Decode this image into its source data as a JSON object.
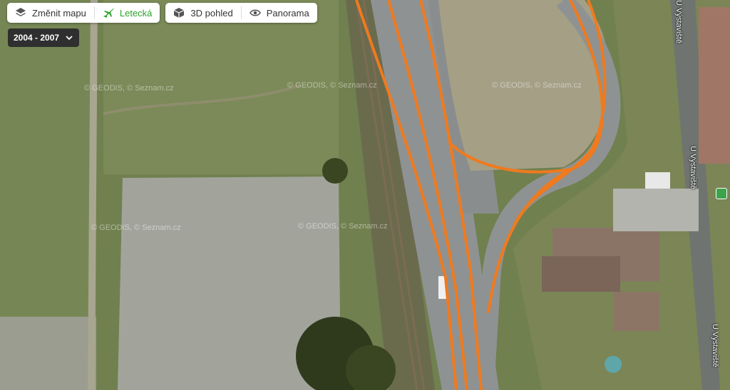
{
  "toolbar": {
    "change_map_label": "Změnit mapu",
    "aerial_label": "Letecká",
    "view3d_label": "3D pohled",
    "panorama_label": "Panorama"
  },
  "date_range": "2004 - 2007",
  "watermarks": [
    "© GEODIS, © Seznam.cz",
    "© GEODIS, © Seznam.cz",
    "© GEODIS, © Seznam.cz",
    "© GEODIS, © Seznam.cz",
    "© GEODIS, © Seznam.cz"
  ],
  "streets": [
    "U Výstaviště",
    "U Výstaviště",
    "U Výstaviště"
  ],
  "colors": {
    "route": "#f07a1e",
    "active": "#2aa52a",
    "road": "#8f9292"
  },
  "icons": [
    "layers-icon",
    "plane-icon",
    "cube-3d-icon",
    "eye-icon",
    "chevron-down-icon",
    "shop-poi-icon"
  ]
}
